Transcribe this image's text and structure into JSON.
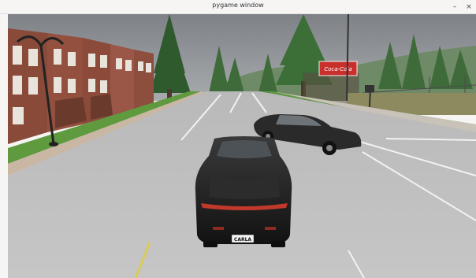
{
  "window": {
    "title": "pygame window",
    "minimize_glyph": "–",
    "close_glyph": "×"
  },
  "scene": {
    "billboard_text": "Coca-Cola",
    "license_plate": "CARLA",
    "colors": {
      "sky": "#8c8f93",
      "road": "#bdbdbd",
      "grass": "#5f9a3e",
      "brick": "#8a4a3a",
      "ego_car": "#1e1e1e",
      "other_car": "#2a2a2a",
      "tail_light": "#c0392b"
    }
  }
}
